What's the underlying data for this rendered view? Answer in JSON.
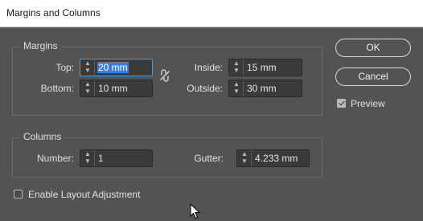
{
  "window": {
    "title": "Margins and Columns"
  },
  "margins": {
    "legend": "Margins",
    "top_label": "Top:",
    "top_value": "20 mm",
    "bottom_label": "Bottom:",
    "bottom_value": "10 mm",
    "inside_label": "Inside:",
    "inside_value": "15 mm",
    "outside_label": "Outside:",
    "outside_value": "30 mm",
    "link_icon": "chain-broken-icon"
  },
  "columns": {
    "legend": "Columns",
    "number_label": "Number:",
    "number_value": "1",
    "gutter_label": "Gutter:",
    "gutter_value": "4.233 mm"
  },
  "buttons": {
    "ok": "OK",
    "cancel": "Cancel"
  },
  "preview": {
    "label": "Preview",
    "checked": true
  },
  "layout_adjustment": {
    "label": "Enable Layout Adjustment",
    "checked": false
  },
  "colors": {
    "dialog_bg": "#535353",
    "selection": "#3d7dd9",
    "focus_border": "#4f9bd8"
  }
}
